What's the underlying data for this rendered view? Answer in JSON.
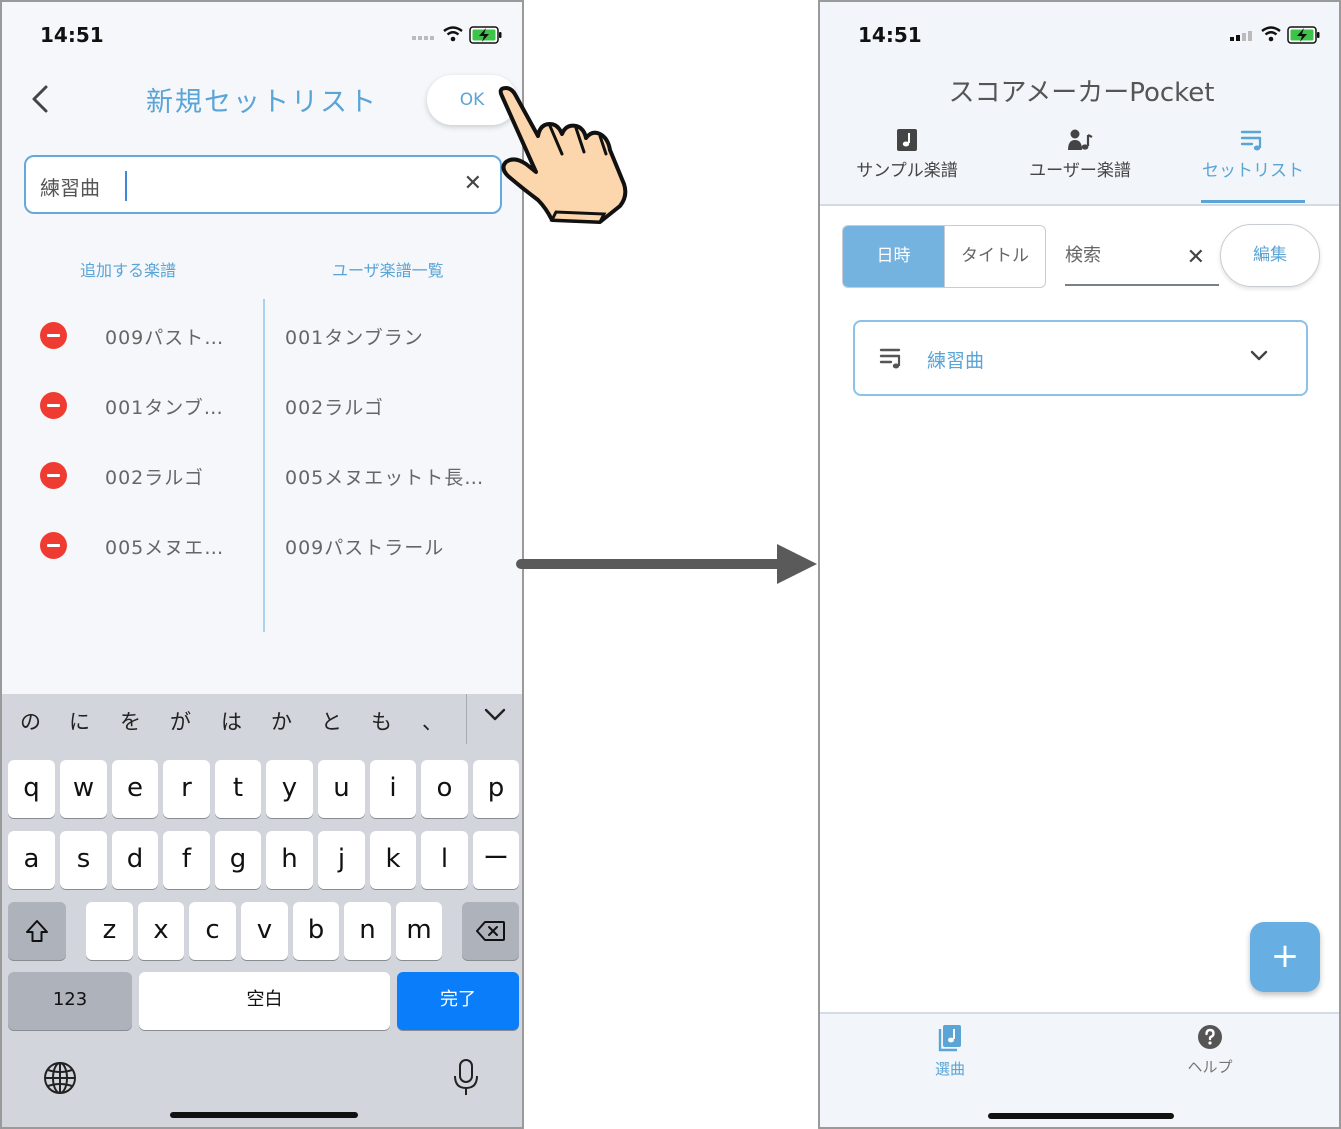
{
  "left_screen": {
    "status": {
      "time": "14:51"
    },
    "title": "新規セットリスト",
    "ok_label": "OK",
    "name_input": {
      "value": "練習曲",
      "clear_icon": "✕"
    },
    "columns": {
      "added_header": "追加する楽譜",
      "user_header": "ユーザ楽譜一覧"
    },
    "added_items": [
      "009パスト…",
      "001タンブ…",
      "002ラルゴ",
      "005メヌエ…"
    ],
    "user_items": [
      "001タンブラン",
      "002ラルゴ",
      "005メヌエットト長…",
      "009パストラール"
    ],
    "keyboard": {
      "candidates": [
        "の",
        "に",
        "を",
        "が",
        "は",
        "か",
        "と",
        "も",
        "、"
      ],
      "row1": [
        "q",
        "w",
        "e",
        "r",
        "t",
        "y",
        "u",
        "i",
        "o",
        "p"
      ],
      "row2": [
        "a",
        "s",
        "d",
        "f",
        "g",
        "h",
        "j",
        "k",
        "l",
        "ー"
      ],
      "row3": [
        "z",
        "x",
        "c",
        "v",
        "b",
        "n",
        "m"
      ],
      "numbers_label": "123",
      "space_label": "空白",
      "done_label": "完了"
    }
  },
  "right_screen": {
    "status": {
      "time": "14:51"
    },
    "app_title": "スコアメーカーPocket",
    "tabs": [
      {
        "label": "サンプル楽譜",
        "icon": "sheet-music-icon"
      },
      {
        "label": "ユーザー楽譜",
        "icon": "user-music-icon"
      },
      {
        "label": "セットリスト",
        "icon": "playlist-icon"
      }
    ],
    "active_tab": "セットリスト",
    "sort": {
      "date_label": "日時",
      "title_label": "タイトル",
      "selected": "日時"
    },
    "search": {
      "placeholder": "検索",
      "clear_icon": "✕"
    },
    "edit_label": "編集",
    "setlists": [
      {
        "name": "練習曲"
      }
    ],
    "fab_label": "+",
    "bottom_tabs": [
      {
        "label": "選曲",
        "icon": "music-book-icon"
      },
      {
        "label": "ヘルプ",
        "icon": "help-icon"
      }
    ],
    "active_bottom_tab": "選曲"
  },
  "colors": {
    "accent": "#5aa4d6",
    "remove": "#ef3c32",
    "keyboard_blue": "#0a7dfa",
    "hand_skin": "#fcd6ac"
  }
}
